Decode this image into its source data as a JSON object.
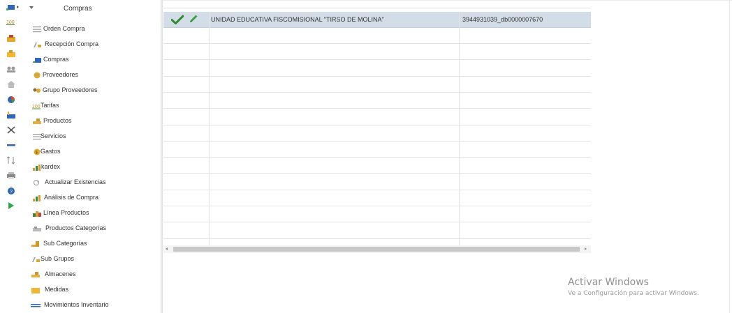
{
  "menu": {
    "title": "Compras",
    "items": [
      {
        "label": "Orden Compra",
        "icon": "list-icon"
      },
      {
        "label": "Recepción Compra",
        "icon": "receive-icon"
      },
      {
        "label": "Compras",
        "icon": "purchases-icon"
      },
      {
        "label": "Proveedores",
        "icon": "supplier-icon"
      },
      {
        "label": "Grupo Proveedores",
        "icon": "supplier-group-icon"
      },
      {
        "label": "Tarifas",
        "icon": "rates-icon"
      },
      {
        "label": "Productos",
        "icon": "products-icon"
      },
      {
        "label": "Servicios",
        "icon": "list-icon"
      },
      {
        "label": "Gastos",
        "icon": "expenses-icon"
      },
      {
        "label": "kardex",
        "icon": "bar-chart-icon"
      },
      {
        "label": "Actualizar Existencias",
        "icon": "refresh-icon"
      },
      {
        "label": "Análisis de Compra",
        "icon": "bar-chart-icon"
      },
      {
        "label": "Línea Productos",
        "icon": "product-line-icon"
      },
      {
        "label": "Productos Categorías",
        "icon": "categories-icon"
      },
      {
        "label": "Sub Categorías",
        "icon": "subcategories-icon"
      },
      {
        "label": "Sub Grupos",
        "icon": "receive-icon"
      },
      {
        "label": "Almacenes",
        "icon": "products-icon"
      },
      {
        "label": "Medidas",
        "icon": "folder-icon"
      },
      {
        "label": "Movimientos Inventario",
        "icon": "movements-icon"
      }
    ]
  },
  "strip_icons": [
    "module-icon",
    "percent-icon",
    "box-icon",
    "folder-open-icon",
    "users-icon",
    "home-icon",
    "pie-chart-icon",
    "factory-icon",
    "tools-icon",
    "minus-icon",
    "sort-icon",
    "printer-icon",
    "help-icon",
    "play-icon"
  ],
  "grid": {
    "selected_row": {
      "name": "UNIDAD EDUCATIVA FISCOMISIONAL \"TIRSO DE MOLINA\"",
      "id": "3944931039_db0000007670"
    },
    "empty_rows": 13
  },
  "watermark": {
    "title": "Activar Windows",
    "subtitle": "Ve a Configuración para activar Windows."
  },
  "colors": {
    "selected_row": "#d3dde7",
    "check": "#2e8b2e",
    "pencil": "#3aa03a"
  }
}
